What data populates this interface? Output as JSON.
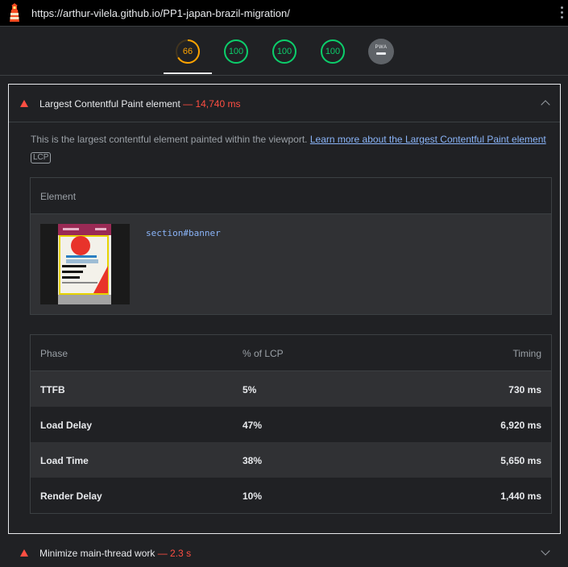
{
  "browser": {
    "url": "https://arthur-vilela.github.io/PP1-japan-brazil-migration/",
    "logo_icon": "lighthouse-icon",
    "menu_icon": "kebab-menu-icon"
  },
  "gauges": [
    {
      "score": "66",
      "fraction": 0.66,
      "color": "#ffa400"
    },
    {
      "score": "100",
      "fraction": 1.0,
      "color": "#0cce6b"
    },
    {
      "score": "100",
      "fraction": 1.0,
      "color": "#0cce6b"
    },
    {
      "score": "100",
      "fraction": 1.0,
      "color": "#0cce6b"
    }
  ],
  "pwa": {
    "label": "PWA"
  },
  "audit": {
    "title": "Largest Contentful Paint element",
    "separator": " — ",
    "value": "14,740 ms",
    "status_color": "#ff4e42",
    "description": "This is the largest contentful element painted within the viewport. ",
    "link_text": "Learn more about the Largest Contentful Paint element",
    "tag": "LCP",
    "element_table": {
      "header": "Element",
      "selector": "section#banner"
    },
    "phase_table": {
      "headers": [
        "Phase",
        "% of LCP",
        "Timing"
      ],
      "rows": [
        {
          "phase": "TTFB",
          "percent": "5%",
          "timing": "730 ms"
        },
        {
          "phase": "Load Delay",
          "percent": "47%",
          "timing": "6,920 ms"
        },
        {
          "phase": "Load Time",
          "percent": "38%",
          "timing": "5,650 ms"
        },
        {
          "phase": "Render Delay",
          "percent": "10%",
          "timing": "1,440 ms"
        }
      ]
    }
  },
  "audit2": {
    "title": "Minimize main-thread work",
    "separator": " — ",
    "value": "2.3 s"
  }
}
